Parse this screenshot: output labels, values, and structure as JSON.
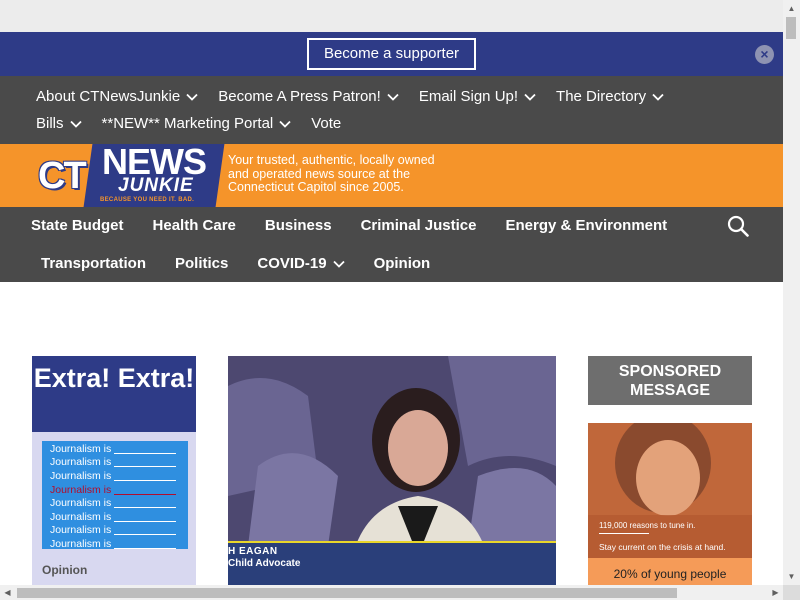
{
  "support_bar": {
    "button_label": "Become a supporter",
    "close_icon": "close-icon",
    "close_glyph": "×"
  },
  "utility_nav": {
    "items": [
      {
        "label": "About CTNewsJunkie",
        "has_dropdown": true
      },
      {
        "label": "Become A Press Patron!",
        "has_dropdown": true
      },
      {
        "label": "Email Sign Up!",
        "has_dropdown": true
      },
      {
        "label": "The Directory",
        "has_dropdown": true
      },
      {
        "label": "Bills",
        "has_dropdown": true
      },
      {
        "label": "**NEW** Marketing Portal",
        "has_dropdown": true
      },
      {
        "label": "Vote",
        "has_dropdown": false
      }
    ]
  },
  "brand": {
    "logo_ct": "CT",
    "logo_news": "NEWS",
    "logo_junkie": "JUNKIE",
    "logo_tagline": "BECAUSE YOU NEED IT. BAD.",
    "tagline": "Your trusted, authentic, locally owned and operated news source at the Connecticut Capitol since 2005."
  },
  "main_nav": {
    "items": [
      {
        "label": "State Budget",
        "has_dropdown": false
      },
      {
        "label": "Health Care",
        "has_dropdown": false
      },
      {
        "label": "Business",
        "has_dropdown": false
      },
      {
        "label": "Criminal Justice",
        "has_dropdown": false
      },
      {
        "label": "Energy & Environment",
        "has_dropdown": false
      },
      {
        "label": "Transportation",
        "has_dropdown": false
      },
      {
        "label": "Politics",
        "has_dropdown": false
      },
      {
        "label": "COVID-19",
        "has_dropdown": true
      },
      {
        "label": "Opinion",
        "has_dropdown": false
      }
    ],
    "search_icon": "search-icon"
  },
  "left_promo": {
    "headline": "Extra! Extra!",
    "lines": [
      {
        "text": "Journalism is",
        "highlight": false
      },
      {
        "text": "Journalism is",
        "highlight": false
      },
      {
        "text": "Journalism is",
        "highlight": false
      },
      {
        "text": "Journalism is",
        "highlight": true
      },
      {
        "text": "Journalism is",
        "highlight": false
      },
      {
        "text": "Journalism is",
        "highlight": false
      },
      {
        "text": "Journalism is",
        "highlight": false
      },
      {
        "text": "Journalism is",
        "highlight": false
      }
    ],
    "category": "Opinion"
  },
  "hero": {
    "caption_name": "H  EAGAN",
    "caption_role": "Child Advocate"
  },
  "sponsored": {
    "label": "SPONSORED MESSAGE",
    "ad_line1": "119,000 reasons to tune in.",
    "ad_line2": "Stay current on the crisis at hand.",
    "ad_line3": "20% of young people"
  },
  "colors": {
    "navy": "#2e3b87",
    "orange": "#f5942a",
    "nav_gray": "#4a4a4a",
    "promo_blue": "#2f8fe0",
    "promo_bg": "#d8d8f0",
    "highlight_red": "#b30d2c"
  }
}
